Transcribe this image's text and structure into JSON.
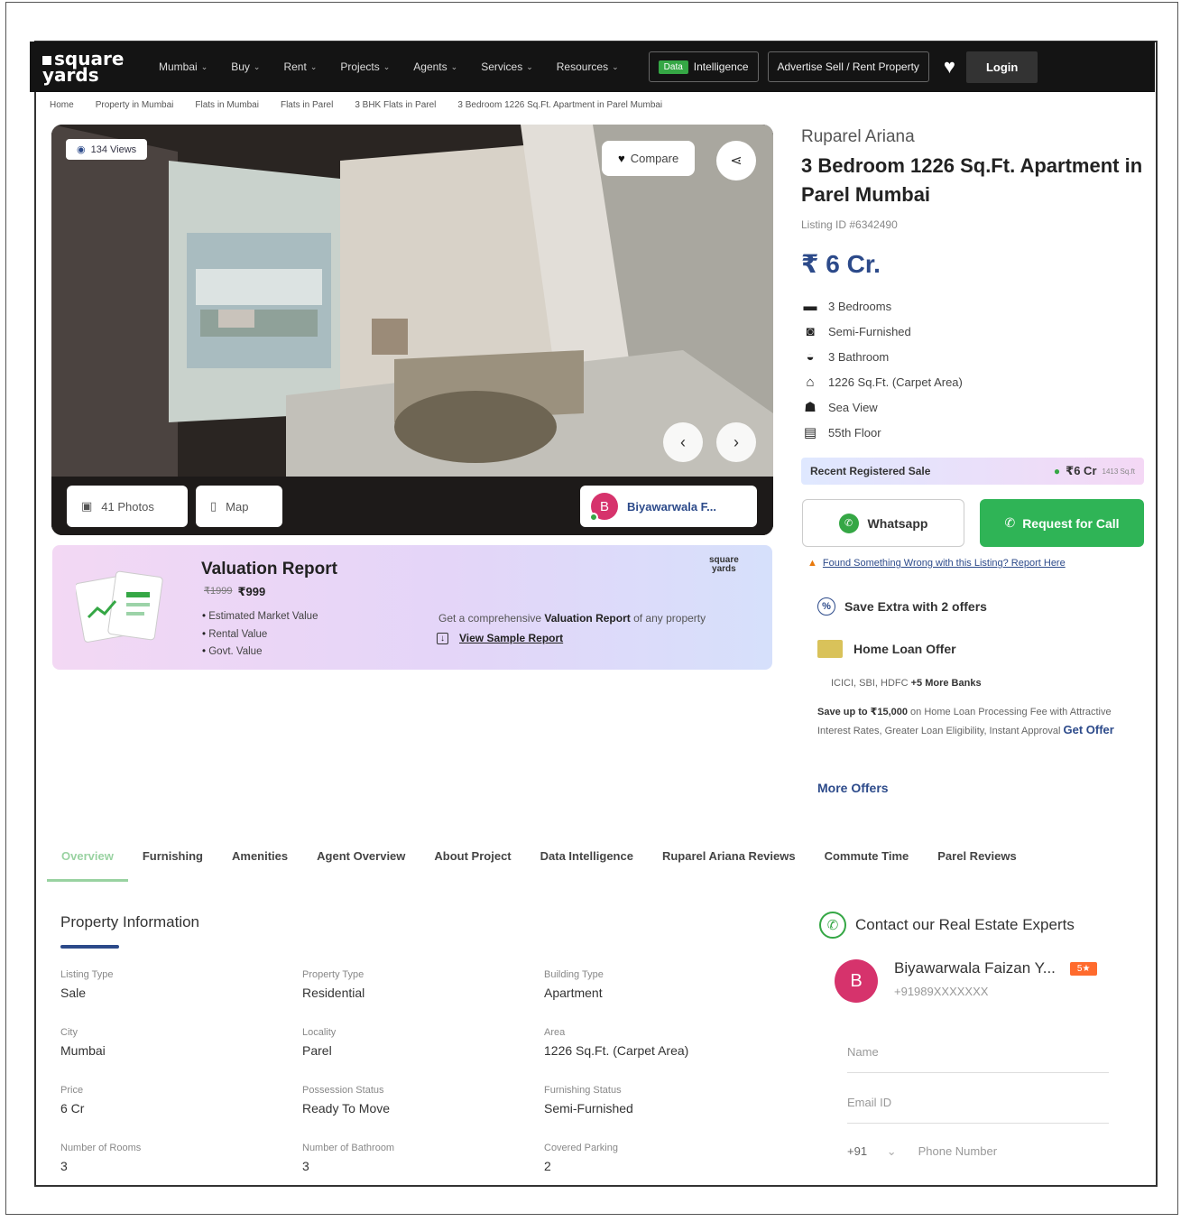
{
  "nav": {
    "logo_top": "square",
    "logo_bottom": "yards",
    "items": [
      {
        "label": "Mumbai"
      },
      {
        "label": "Buy"
      },
      {
        "label": "Rent"
      },
      {
        "label": "Projects"
      },
      {
        "label": "Agents"
      },
      {
        "label": "Services"
      },
      {
        "label": "Resources"
      }
    ],
    "data_tag": "Data",
    "intelligence": "Intelligence",
    "advertise": "Advertise Sell / Rent Property",
    "login": "Login"
  },
  "breadcrumb": [
    "Home",
    "Property in Mumbai",
    "Flats in Mumbai",
    "Flats in Parel",
    "3 BHK Flats in Parel",
    "3 Bedroom 1226 Sq.Ft. Apartment in Parel Mumbai"
  ],
  "gallery": {
    "views": "134 Views",
    "compare": "Compare",
    "photos": "41 Photos",
    "map": "Map",
    "agent_initial": "B",
    "agent_short": "Biyawarwala F..."
  },
  "valuation": {
    "title": "Valuation Report",
    "old_price": "₹1999",
    "price": "₹999",
    "points": [
      "Estimated Market Value",
      "Rental Value",
      "Govt. Value"
    ],
    "logo_top": "square",
    "logo_bottom": "yards",
    "desc_pre": "Get a comprehensive ",
    "desc_bold": "Valuation Report",
    "desc_post": " of any property",
    "sample": "View Sample Report"
  },
  "listing": {
    "project": "Ruparel Ariana",
    "title": "3 Bedroom 1226 Sq.Ft. Apartment in Parel Mumbai",
    "listing_id": "Listing ID #6342490",
    "price": "₹ 6 Cr.",
    "features": [
      {
        "icon": "bed-icon",
        "glyph": "▬",
        "label": "3 Bedrooms"
      },
      {
        "icon": "sofa-icon",
        "glyph": "◙",
        "label": "Semi-Furnished"
      },
      {
        "icon": "bathtub-icon",
        "glyph": "◒",
        "label": "3 Bathroom"
      },
      {
        "icon": "home-icon",
        "glyph": "⌂",
        "label": "1226 Sq.Ft. (Carpet Area)"
      },
      {
        "icon": "sea-view-icon",
        "glyph": "☗",
        "label": "Sea View"
      },
      {
        "icon": "floor-icon",
        "glyph": "▤",
        "label": "55th Floor"
      }
    ],
    "recent_sale_label": "Recent Registered Sale",
    "recent_sale_value": "₹6 Cr",
    "recent_sale_small": "1413 Sq.ft",
    "whatsapp": "Whatsapp",
    "call": "Request for Call",
    "report_wrong": "Found Something Wrong with this Listing? Report Here"
  },
  "offers": {
    "head": "Save Extra with 2 offers",
    "loan_head": "Home Loan Offer",
    "banks_plain": "ICICI, SBI, HDFC ",
    "banks_bold": "+5 More Banks",
    "desc_bold": "Save up to ₹15,000",
    "desc": " on Home Loan Processing Fee with Attractive Interest Rates, Greater Loan Eligibility, Instant Approval ",
    "get_offer": "Get Offer",
    "more": "More Offers"
  },
  "tabs": [
    "Overview",
    "Furnishing",
    "Amenities",
    "Agent Overview",
    "About Project",
    "Data Intelligence",
    "Ruparel Ariana Reviews",
    "Commute Time",
    "Parel Reviews"
  ],
  "property_info": {
    "title": "Property Information",
    "cells": [
      {
        "label": "Listing Type",
        "value": "Sale"
      },
      {
        "label": "Property Type",
        "value": "Residential"
      },
      {
        "label": "Building Type",
        "value": "Apartment"
      },
      {
        "label": "City",
        "value": "Mumbai"
      },
      {
        "label": "Locality",
        "value": "Parel"
      },
      {
        "label": "Area",
        "value": "1226 Sq.Ft. (Carpet Area)"
      },
      {
        "label": "Price",
        "value": "6 Cr"
      },
      {
        "label": "Possession Status",
        "value": "Ready To Move"
      },
      {
        "label": "Furnishing Status",
        "value": "Semi-Furnished"
      },
      {
        "label": "Number of Rooms",
        "value": "3"
      },
      {
        "label": "Number of Bathroom",
        "value": "3"
      },
      {
        "label": "Covered Parking",
        "value": "2"
      }
    ]
  },
  "contact": {
    "head": "Contact our Real Estate Experts",
    "initial": "B",
    "name": "Biyawarwala Faizan Y...",
    "badge": "5★",
    "phone": "+91989XXXXXXX",
    "name_placeholder": "Name",
    "email_placeholder": "Email ID",
    "code": "+91",
    "phone_placeholder": "Phone Number"
  }
}
